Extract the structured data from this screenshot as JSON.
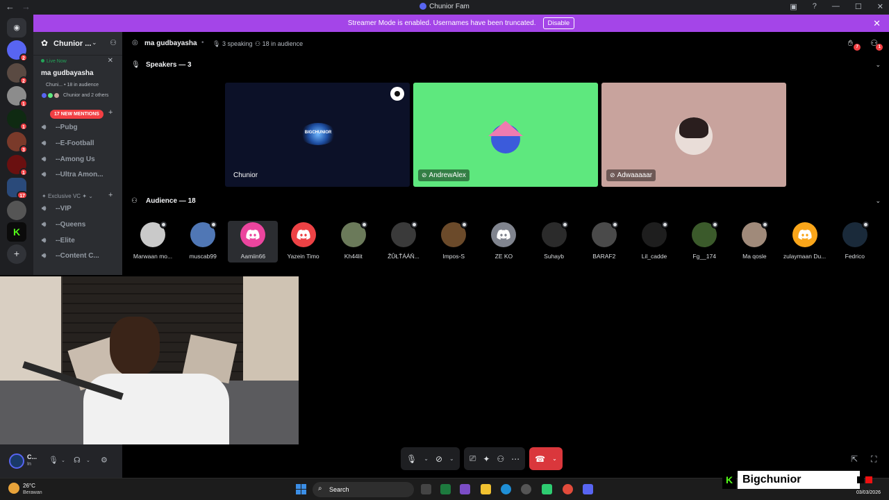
{
  "window": {
    "title": "Chunior Fam",
    "nav_back": "←",
    "nav_forward": "→"
  },
  "banner": {
    "text": "Streamer Mode is enabled. Usernames have been truncated.",
    "button": "Disable",
    "close": "✕"
  },
  "rail": {
    "badges": [
      "2",
      "2",
      "1",
      "1",
      "3",
      "1",
      "17"
    ]
  },
  "sidebar": {
    "server_name": "Chunior ...",
    "live_now": "Live Now",
    "stage_name": "ma gudbayasha",
    "stage_meta": "Chuni... • 18 in audience",
    "stage_who": "Chunior and 2 others",
    "mentions": "17 NEW MENTIONS",
    "channels_a": [
      {
        "label": "--Pubg"
      },
      {
        "label": "--E-Football"
      },
      {
        "label": "--Among Us"
      },
      {
        "label": "--Ultra Amon..."
      }
    ],
    "category_b": "Exclusive VC",
    "channels_b": [
      {
        "label": "--VIP"
      },
      {
        "label": "--Queens"
      },
      {
        "label": "--Elite"
      },
      {
        "label": "--Content C..."
      }
    ]
  },
  "stage": {
    "title": "ma gudbayasha",
    "speaking": "3 speaking",
    "audience": "18 in audience",
    "hand_badge": "7",
    "invite_badge": "1",
    "speakers_title": "Speakers — 3",
    "audience_title": "Audience — 18",
    "speakers": [
      {
        "name": "Chunior",
        "bg": "#0c1128"
      },
      {
        "name": "AndrewAlex",
        "bg": "#5ee87e"
      },
      {
        "name": "Adwaaaaar",
        "bg": "#c8a39d"
      }
    ],
    "audience_list": [
      {
        "name": "Marwaan mo...",
        "color": "#c9c9c9"
      },
      {
        "name": "muscab99",
        "color": "#5077b5"
      },
      {
        "name": "Aamiin66",
        "color": "#eb459e"
      },
      {
        "name": "Yazein Timo",
        "color": "#ed4245"
      },
      {
        "name": "Kh44lit",
        "color": "#6b7a5a"
      },
      {
        "name": "ŽÛŁŤÁÁŇ...",
        "color": "#3a3a3a"
      },
      {
        "name": "Impos-S",
        "color": "#6b4a2a"
      },
      {
        "name": "ZE KO",
        "color": "#80848e"
      },
      {
        "name": "Suhayb",
        "color": "#2b2b2b"
      },
      {
        "name": "BARAF2",
        "color": "#4a4a4a"
      },
      {
        "name": "Lil_cadde",
        "color": "#1e1e1e"
      },
      {
        "name": "Fg__174",
        "color": "#3b5a2b"
      },
      {
        "name": "Ma qosle",
        "color": "#a08a7a"
      },
      {
        "name": "zulaymaan Du...",
        "color": "#faa61a"
      },
      {
        "name": "Fedrico",
        "color": "#1a2a3a"
      }
    ]
  },
  "user_panel": {
    "name": "C...",
    "status": "In"
  },
  "taskbar": {
    "temp": "26°C",
    "condition": "Berawan",
    "search": "Search",
    "date": "03/03/2026"
  },
  "overlay": {
    "k": "K",
    "channel": "Bigchunior"
  },
  "colors": {
    "accent": "#5865f2",
    "banner": "#a445e8",
    "danger": "#da373c",
    "kick_green": "#53fc18"
  }
}
